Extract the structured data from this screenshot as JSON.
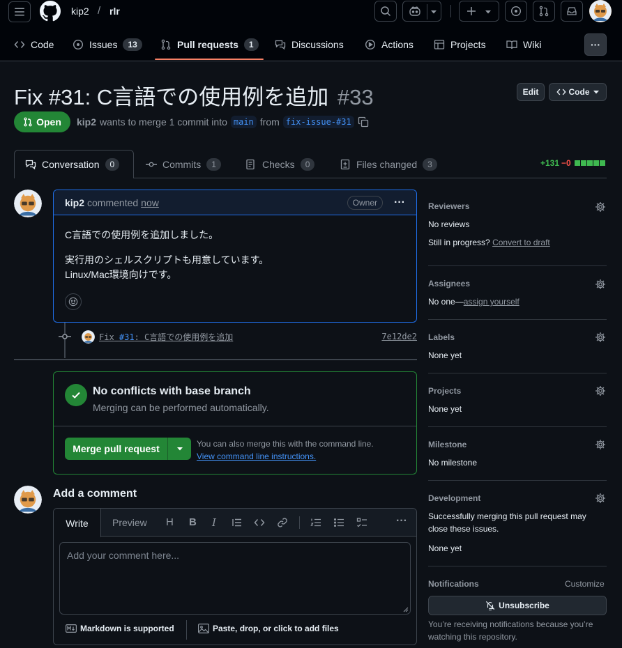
{
  "header": {
    "owner": "kip2",
    "separator": "/",
    "repo": "rlr"
  },
  "repo_nav": {
    "items": [
      {
        "label": "Code",
        "icon": "code-icon"
      },
      {
        "label": "Issues",
        "icon": "issue-icon",
        "count": "13"
      },
      {
        "label": "Pull requests",
        "icon": "pull-request-icon",
        "count": "1"
      },
      {
        "label": "Discussions",
        "icon": "comment-discussion-icon"
      },
      {
        "label": "Actions",
        "icon": "play-icon"
      },
      {
        "label": "Projects",
        "icon": "table-icon"
      },
      {
        "label": "Wiki",
        "icon": "book-icon"
      }
    ],
    "more_label": "···"
  },
  "pr": {
    "title": "Fix #31: C言語での使用例を追加",
    "number": "#33",
    "edit_label": "Edit",
    "code_label": "Code",
    "status": "Open",
    "author": "kip2",
    "meta_text": "wants to merge 1 commit into",
    "base_branch": "main",
    "from_text": "from",
    "head_branch": "fix-issue-#31"
  },
  "tabs": [
    {
      "label": "Conversation",
      "count": "0"
    },
    {
      "label": "Commits",
      "count": "1"
    },
    {
      "label": "Checks",
      "count": "0"
    },
    {
      "label": "Files changed",
      "count": "3"
    }
  ],
  "diffstat": {
    "additions": "+131",
    "deletions": "−0"
  },
  "comment": {
    "author": "kip2",
    "action": "commented",
    "time": "now",
    "role": "Owner",
    "menu": "···",
    "body_p1": "C言語での使用例を追加しました。",
    "body_p2_line1": "実行用のシェルスクリプトも用意しています。",
    "body_p2_line2": "Linux/Mac環境向けです。"
  },
  "commit": {
    "prefix": "Fix",
    "issue_ref": "#31",
    "message": ": C言語での使用例を追加",
    "sha": "7e12de2"
  },
  "merge": {
    "title": "No conflicts with base branch",
    "subtitle": "Merging can be performed automatically.",
    "button_label": "Merge pull request",
    "hint": "You can also merge this with the command line.",
    "hint_link": "View command line instructions."
  },
  "new_comment": {
    "heading": "Add a comment",
    "tab_write": "Write",
    "tab_preview": "Preview",
    "placeholder": "Add your comment here...",
    "markdown_note": "Markdown is supported",
    "attach_note": "Paste, drop, or click to add files"
  },
  "sidebar": {
    "reviewers": {
      "heading": "Reviewers",
      "value": "No reviews",
      "draft_prefix": "Still in progress?",
      "draft_link": "Convert to draft"
    },
    "assignees": {
      "heading": "Assignees",
      "value_prefix": "No one—",
      "value_link": "assign yourself"
    },
    "labels": {
      "heading": "Labels",
      "value": "None yet"
    },
    "projects": {
      "heading": "Projects",
      "value": "None yet"
    },
    "milestone": {
      "heading": "Milestone",
      "value": "No milestone"
    },
    "development": {
      "heading": "Development",
      "line1": "Successfully merging this pull request may",
      "line2": "close these issues.",
      "value": "None yet"
    },
    "notifications": {
      "heading": "Notifications",
      "customize": "Customize",
      "button": "Unsubscribe",
      "note_line1": "You’re receiving notifications because you’re",
      "note_line2": "watching this repository."
    }
  },
  "colors": {
    "background": "#0d1117",
    "header_bg": "#010409",
    "border": "#3d444d",
    "accent_green": "#238636",
    "link_blue": "#4493f8",
    "muted": "#9198a1",
    "nav_underline": "#f78166"
  }
}
